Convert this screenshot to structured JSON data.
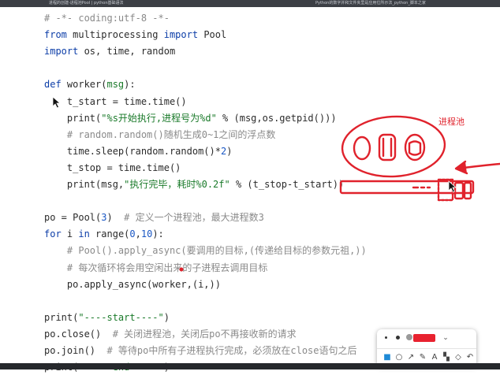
{
  "window": {
    "tab_left": "进程的创建-进程池Pool | python基础语法",
    "tab_right": "Python的数字并和文件夹里是应用位所示法_python_脚本之家"
  },
  "code_lines": [
    {
      "segs": [
        {
          "t": "# -*- coding:utf-8 -*-",
          "c": "cm"
        }
      ]
    },
    {
      "segs": [
        {
          "t": "from",
          "c": "kw"
        },
        {
          "t": " multiprocessing ",
          "c": ""
        },
        {
          "t": "import",
          "c": "kw"
        },
        {
          "t": " Pool",
          "c": ""
        }
      ]
    },
    {
      "segs": [
        {
          "t": "import",
          "c": "kw"
        },
        {
          "t": " os, time, random",
          "c": ""
        }
      ]
    },
    {
      "segs": []
    },
    {
      "segs": [
        {
          "t": "def",
          "c": "kw"
        },
        {
          "t": " worker(",
          "c": ""
        },
        {
          "t": "msg",
          "c": "str"
        },
        {
          "t": "):",
          "c": ""
        }
      ]
    },
    {
      "segs": [
        {
          "t": "    t_start = time.time()",
          "c": ""
        }
      ]
    },
    {
      "segs": [
        {
          "t": "    print(",
          "c": ""
        },
        {
          "t": "\"%s开始执行,进程号为%d\"",
          "c": "str"
        },
        {
          "t": " % (msg,os.getpid()))",
          "c": ""
        }
      ]
    },
    {
      "segs": [
        {
          "t": "    # random.random()随机生成0~1之间的浮点数",
          "c": "cm"
        }
      ]
    },
    {
      "segs": [
        {
          "t": "    time.sleep(random.random()*",
          "c": ""
        },
        {
          "t": "2",
          "c": "num"
        },
        {
          "t": ")",
          "c": ""
        }
      ]
    },
    {
      "segs": [
        {
          "t": "    t_stop = time.time()",
          "c": ""
        }
      ]
    },
    {
      "segs": [
        {
          "t": "    print(msg,",
          "c": ""
        },
        {
          "t": "\"执行完毕，耗时%0.2f\"",
          "c": "str"
        },
        {
          "t": " % (t_stop-t_start))",
          "c": ""
        }
      ]
    },
    {
      "segs": []
    },
    {
      "segs": [
        {
          "t": "po = Pool(",
          "c": ""
        },
        {
          "t": "3",
          "c": "num"
        },
        {
          "t": ")  ",
          "c": ""
        },
        {
          "t": "# 定义一个进程池，最大进程数3",
          "c": "cm"
        }
      ]
    },
    {
      "segs": [
        {
          "t": "for",
          "c": "kw"
        },
        {
          "t": " i ",
          "c": ""
        },
        {
          "t": "in",
          "c": "kw"
        },
        {
          "t": " range(",
          "c": ""
        },
        {
          "t": "0",
          "c": "num"
        },
        {
          "t": ",",
          "c": ""
        },
        {
          "t": "10",
          "c": "num"
        },
        {
          "t": "):",
          "c": ""
        }
      ]
    },
    {
      "segs": [
        {
          "t": "    # Pool().apply_async(要调用的目标,(传递给目标的参数元祖,))",
          "c": "cm"
        }
      ]
    },
    {
      "segs": [
        {
          "t": "    # 每次循环将会用空闲出来的子进程去调用目标",
          "c": "cm"
        }
      ]
    },
    {
      "segs": [
        {
          "t": "    po.apply_async(worker,(i,))",
          "c": ""
        }
      ]
    },
    {
      "segs": []
    },
    {
      "segs": [
        {
          "t": "print(",
          "c": ""
        },
        {
          "t": "\"----start----\"",
          "c": "str"
        },
        {
          "t": ")",
          "c": ""
        }
      ]
    },
    {
      "segs": [
        {
          "t": "po.close()  ",
          "c": ""
        },
        {
          "t": "# 关闭进程池，关闭后po不再接收新的请求",
          "c": "cm"
        }
      ]
    },
    {
      "segs": [
        {
          "t": "po.join()  ",
          "c": ""
        },
        {
          "t": "# 等待po中所有子进程执行完成，必须放在close语句之后",
          "c": "cm"
        }
      ]
    },
    {
      "segs": [
        {
          "t": "print(",
          "c": ""
        },
        {
          "t": "\"-----end-----\"",
          "c": "str"
        },
        {
          "t": ")",
          "c": ""
        }
      ]
    }
  ],
  "annotation": {
    "label": "进程池",
    "color": "#e0222c"
  },
  "toolbar": {
    "stroke_sizes": [
      "small",
      "medium",
      "large"
    ],
    "color": "#e8222f",
    "chevron": "⌄",
    "tools": [
      {
        "name": "rectangle-tool-icon",
        "glyph": "■",
        "active": true
      },
      {
        "name": "ellipse-tool-icon",
        "glyph": "○",
        "active": false
      },
      {
        "name": "arrow-tool-icon",
        "glyph": "↗",
        "active": false
      },
      {
        "name": "pen-tool-icon",
        "glyph": "✎",
        "active": false
      },
      {
        "name": "text-tool-icon",
        "glyph": "A",
        "active": false
      },
      {
        "name": "mosaic-tool-icon",
        "glyph": "▚",
        "active": false
      },
      {
        "name": "eraser-tool-icon",
        "glyph": "◇",
        "active": false
      },
      {
        "name": "undo-icon",
        "glyph": "↶",
        "active": false
      }
    ]
  }
}
